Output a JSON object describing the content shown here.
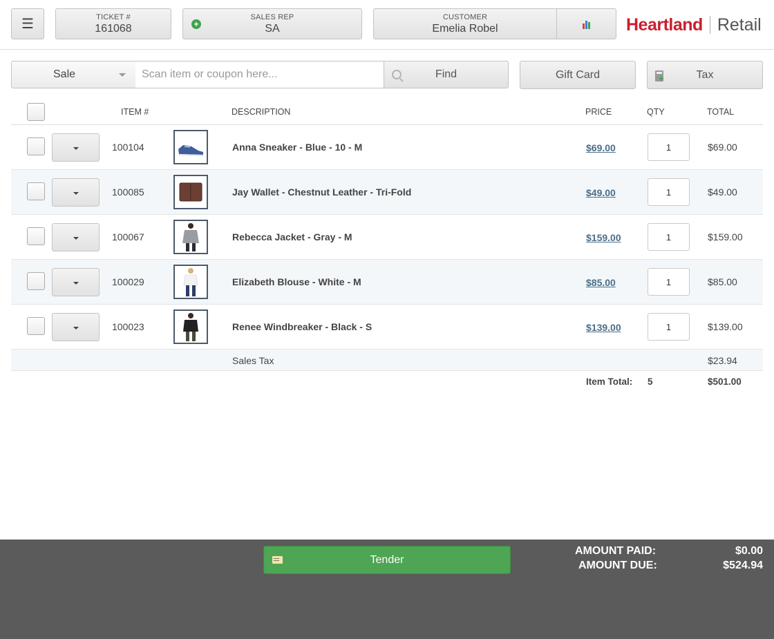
{
  "header": {
    "menu_icon": "hamburger-icon",
    "ticket_label": "TICKET #",
    "ticket_value": "161068",
    "rep_label": "SALES REP",
    "rep_value": "SA",
    "customer_label": "CUSTOMER",
    "customer_value": "Emelia Robel",
    "logo_primary": "Heartland",
    "logo_secondary": "Retail"
  },
  "toolbar": {
    "mode_value": "Sale",
    "scan_placeholder": "Scan item or coupon here...",
    "find_label": "Find",
    "gift_card_label": "Gift Card",
    "tax_label": "Tax"
  },
  "table": {
    "columns": {
      "item_no": "ITEM #",
      "description": "DESCRIPTION",
      "price": "PRICE",
      "qty": "QTY",
      "total": "TOTAL"
    },
    "rows": [
      {
        "item_no": "100104",
        "description": "Anna Sneaker - Blue - 10 - M",
        "price": "$69.00",
        "qty": "1",
        "total": "$69.00",
        "image": "sneaker-thumbnail"
      },
      {
        "item_no": "100085",
        "description": "Jay Wallet - Chestnut Leather - Tri-Fold",
        "price": "$49.00",
        "qty": "1",
        "total": "$49.00",
        "image": "wallet-thumbnail"
      },
      {
        "item_no": "100067",
        "description": "Rebecca Jacket - Gray - M",
        "price": "$159.00",
        "qty": "1",
        "total": "$159.00",
        "image": "jacket-thumbnail"
      },
      {
        "item_no": "100029",
        "description": "Elizabeth Blouse - White - M",
        "price": "$85.00",
        "qty": "1",
        "total": "$85.00",
        "image": "blouse-thumbnail"
      },
      {
        "item_no": "100023",
        "description": "Renee Windbreaker - Black - S",
        "price": "$139.00",
        "qty": "1",
        "total": "$139.00",
        "image": "windbreaker-thumbnail"
      }
    ],
    "tax_label": "Sales Tax",
    "tax_value": "$23.94",
    "item_total_label": "Item Total:",
    "item_total_qty": "5",
    "item_total_value": "$501.00"
  },
  "footer": {
    "tender_label": "Tender",
    "amount_paid_label": "AMOUNT PAID:",
    "amount_paid_value": "$0.00",
    "amount_due_label": "AMOUNT DUE:",
    "amount_due_value": "$524.94"
  },
  "colors": {
    "brand_red": "#c8202f",
    "price_link": "#4a6e8a",
    "tender_green": "#4ea553",
    "footer_bg": "#5b5b5b",
    "alt_row_bg": "#f3f7fa"
  }
}
